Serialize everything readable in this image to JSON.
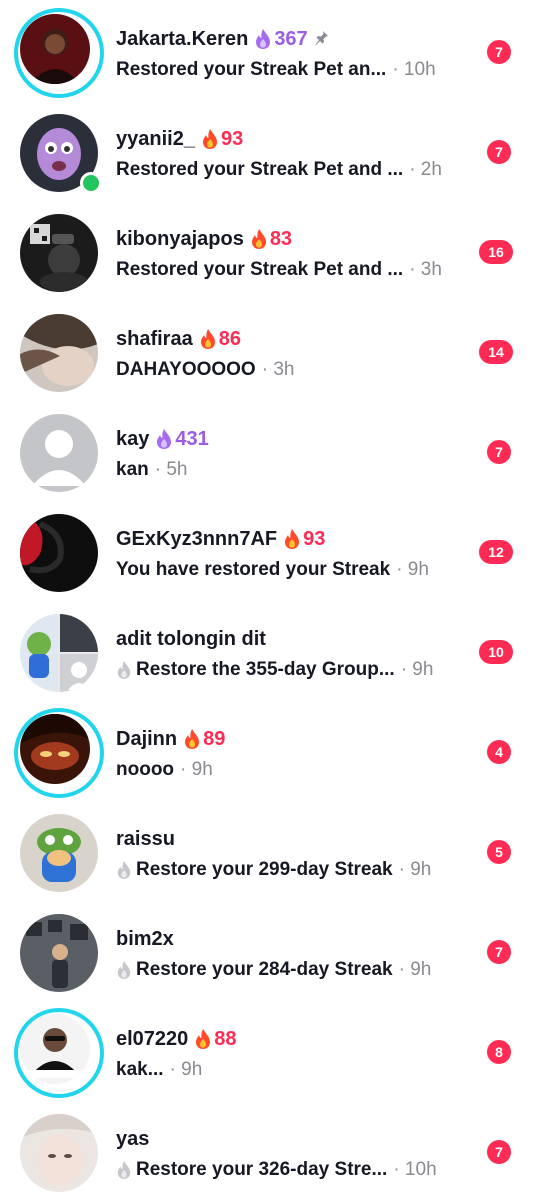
{
  "colors": {
    "accent": "#fe2c55",
    "story_ring": "#20d5ec",
    "streak_purple": "#9b5de5",
    "online": "#22c55e"
  },
  "conversations": [
    {
      "name": "Jakarta.Keren",
      "streak": "367",
      "streak_icon": "purple-flame-icon",
      "pinned": true,
      "message": "Restored your Streak Pet an...",
      "time": "· 10h",
      "unread": "7",
      "story_ring": true
    },
    {
      "name": "yyanii2_",
      "streak": "93",
      "streak_icon": "red-flame-icon",
      "message": "Restored your Streak Pet and ...",
      "time": "· 2h",
      "unread": "7",
      "online": true
    },
    {
      "name": "kibonyajapos",
      "streak": "83",
      "streak_icon": "red-flame-icon",
      "message": "Restored your Streak Pet and ...",
      "time": "· 3h",
      "unread": "16"
    },
    {
      "name": "shafiraa",
      "streak": "86",
      "streak_icon": "red-flame-icon",
      "message": "DAHAYOOOOO",
      "time": "· 3h",
      "unread": "14"
    },
    {
      "name": "kay",
      "streak": "431",
      "streak_icon": "purple-flame-icon",
      "message": "kan",
      "time": "· 5h",
      "unread": "7",
      "default_avatar": true
    },
    {
      "name": "GExKyz3nnn7AF",
      "streak": "93",
      "streak_icon": "red-flame-icon",
      "message": "You have restored your Streak",
      "time": "· 9h",
      "unread": "12"
    },
    {
      "name": "adit tolongin dit",
      "message": "Restore the 355-day Group...",
      "time": "· 9h",
      "unread": "10",
      "message_icon": "grey-flame-icon",
      "group": true
    },
    {
      "name": "Dajinn",
      "streak": "89",
      "streak_icon": "red-flame-icon",
      "message": "noooo",
      "time": "· 9h",
      "unread": "4",
      "story_ring": true
    },
    {
      "name": "raissu",
      "message": "Restore your 299-day Streak",
      "time": "· 9h",
      "unread": "5",
      "message_icon": "grey-flame-icon"
    },
    {
      "name": "bim2x",
      "message": "Restore your 284-day Streak",
      "time": "· 9h",
      "unread": "7",
      "message_icon": "grey-flame-icon"
    },
    {
      "name": "el07220",
      "streak": "88",
      "streak_icon": "red-flame-icon",
      "message": "kak...",
      "time": "· 9h",
      "unread": "8",
      "story_ring": true
    },
    {
      "name": "yas",
      "message": "Restore your 326-day Stre...",
      "time": "· 10h",
      "unread": "7",
      "message_icon": "grey-flame-icon"
    }
  ]
}
